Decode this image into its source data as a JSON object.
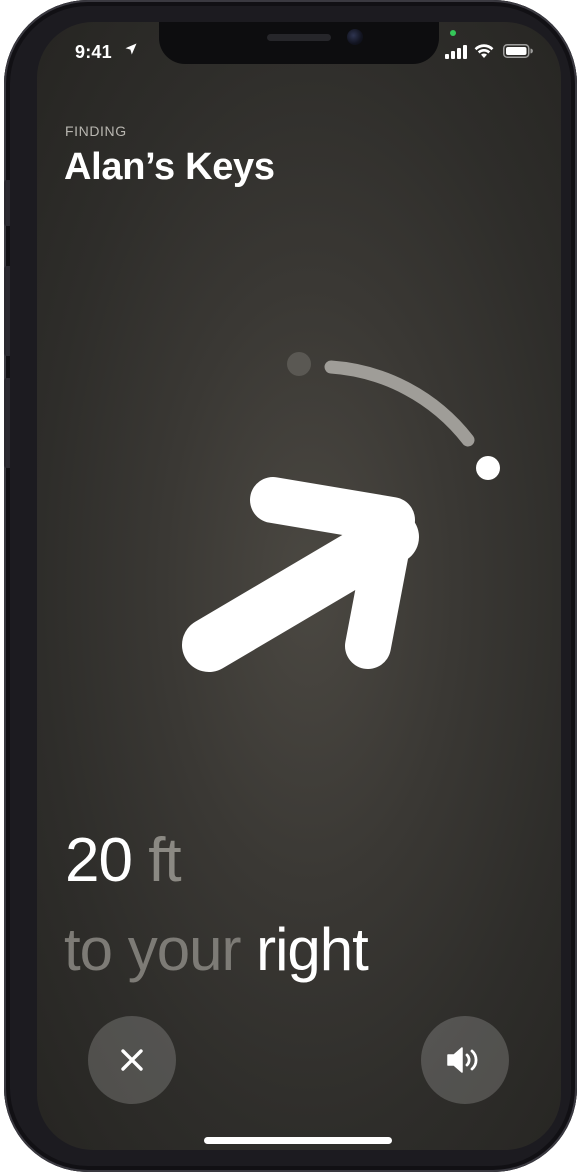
{
  "status_bar": {
    "time": "9:41",
    "icons": [
      "location-arrow-icon",
      "signal-icon",
      "wifi-icon",
      "battery-icon"
    ],
    "privacy_indicator_color": "#35c759"
  },
  "header": {
    "label": "FINDING",
    "title": "Alan’s Keys"
  },
  "compass": {
    "icon": "direction-arrow-icon",
    "heading": "up-right",
    "colors": {
      "arrow": "#ffffff",
      "arc": "#9f9d98",
      "target_dot": "#ffffff",
      "inactive_dot": "#5a5853"
    }
  },
  "distance": {
    "value": "20",
    "unit": "ft"
  },
  "direction": {
    "prefix": "to your",
    "emphasis": "right"
  },
  "actions": {
    "close_icon": "close-icon",
    "sound_icon": "speaker-icon"
  }
}
